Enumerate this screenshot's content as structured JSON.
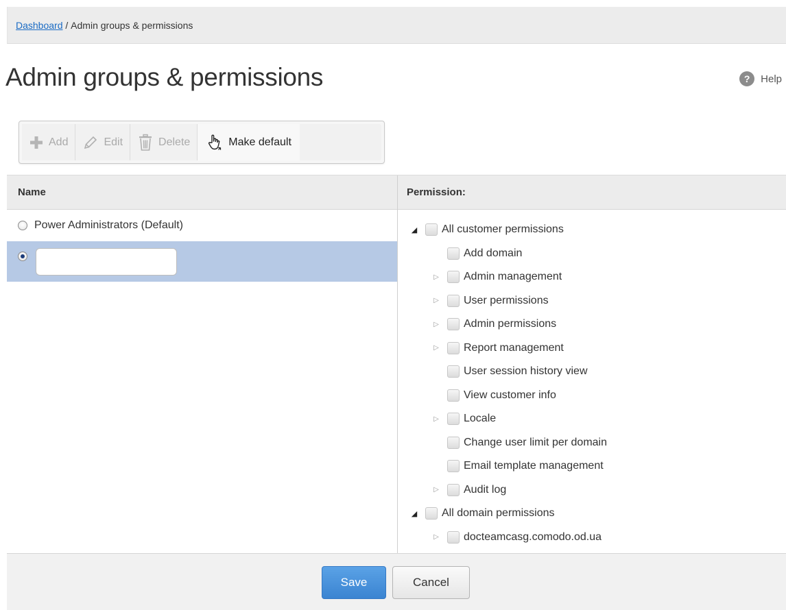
{
  "breadcrumb": {
    "link": "Dashboard",
    "separator": " / ",
    "current": "Admin groups & permissions"
  },
  "page": {
    "title": "Admin groups & permissions",
    "help_label": "Help",
    "help_icon": "question-circle-icon"
  },
  "toolbar": {
    "add_label": "Add",
    "add_icon": "plus-icon",
    "add_enabled": false,
    "edit_label": "Edit",
    "edit_icon": "pencil-icon",
    "edit_enabled": false,
    "delete_label": "Delete",
    "delete_icon": "trash-icon",
    "delete_enabled": false,
    "make_default_label": "Make default",
    "make_default_icon": "hand-pointer-icon",
    "make_default_enabled": true
  },
  "groups": {
    "header": "Name",
    "items": [
      {
        "label": "Power Administrators (Default)",
        "selected": false
      }
    ],
    "new_row": {
      "selected": true,
      "value": "",
      "placeholder": ""
    }
  },
  "permissions": {
    "header": "Permission:",
    "tree": [
      {
        "label": "All customer permissions",
        "level": 0,
        "expandable": true,
        "expanded": true,
        "checked": false
      },
      {
        "label": "Add domain",
        "level": 1,
        "expandable": false,
        "checked": false
      },
      {
        "label": "Admin management",
        "level": 1,
        "expandable": true,
        "expanded": false,
        "checked": false
      },
      {
        "label": "User permissions",
        "level": 1,
        "expandable": true,
        "expanded": false,
        "checked": false
      },
      {
        "label": "Admin permissions",
        "level": 1,
        "expandable": true,
        "expanded": false,
        "checked": false
      },
      {
        "label": "Report management",
        "level": 1,
        "expandable": true,
        "expanded": false,
        "checked": false
      },
      {
        "label": "User session history view",
        "level": 1,
        "expandable": false,
        "checked": false
      },
      {
        "label": "View customer info",
        "level": 1,
        "expandable": false,
        "checked": false
      },
      {
        "label": "Locale",
        "level": 1,
        "expandable": true,
        "expanded": false,
        "checked": false
      },
      {
        "label": "Change user limit per domain",
        "level": 1,
        "expandable": false,
        "checked": false
      },
      {
        "label": "Email template management",
        "level": 1,
        "expandable": false,
        "checked": false
      },
      {
        "label": "Audit log",
        "level": 1,
        "expandable": true,
        "expanded": false,
        "checked": false
      },
      {
        "label": "All domain permissions",
        "level": 0,
        "expandable": true,
        "expanded": true,
        "checked": false
      },
      {
        "label": "docteamcasg.comodo.od.ua",
        "level": 1,
        "expandable": true,
        "expanded": false,
        "checked": false
      }
    ]
  },
  "footer": {
    "save_label": "Save",
    "cancel_label": "Cancel"
  },
  "colors": {
    "accent": "#3b84d1",
    "selection": "#b6c9e5",
    "link": "#1a6bc4"
  }
}
